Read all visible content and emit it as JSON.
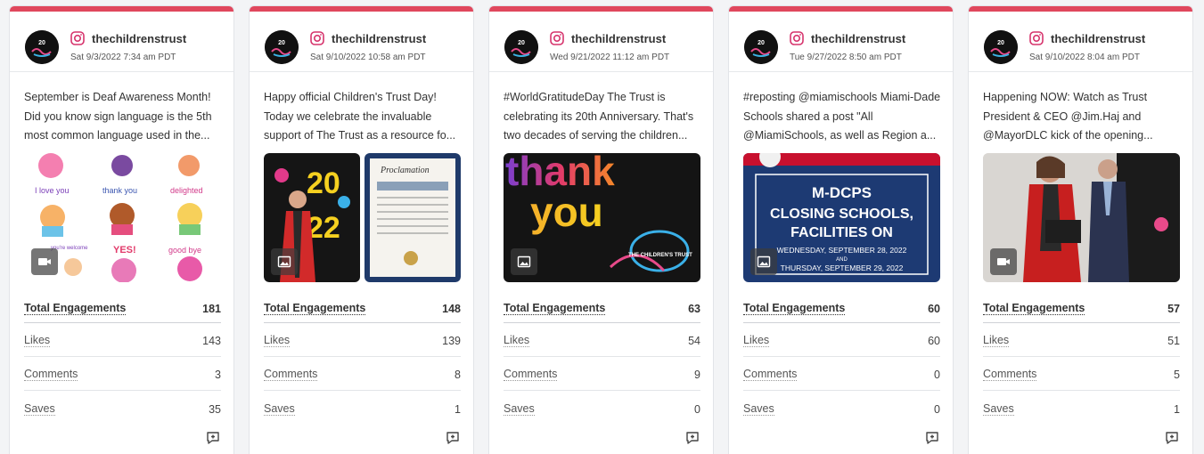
{
  "colors": {
    "accent": "#e0475d",
    "instagram": "#d6336c"
  },
  "metric_labels": {
    "total": "Total Engagements",
    "likes": "Likes",
    "comments": "Comments",
    "saves": "Saves"
  },
  "avatar_text": {
    "logo_year": "20",
    "logo_name": "THE CHILDREN'S TRUST"
  },
  "posts": [
    {
      "handle": "thechildrenstrust",
      "timestamp": "Sat 9/3/2022 7:34 am PDT",
      "caption": "September is Deaf Awareness Month! Did you know sign language is the 5th most common language used in the...",
      "media_type": "video-icon",
      "media_text": [
        "I love you",
        "thank you",
        "delighted",
        "you're welcome",
        "YES!",
        "good bye"
      ],
      "metrics": {
        "total": "181",
        "likes": "143",
        "comments": "3",
        "saves": "35"
      }
    },
    {
      "handle": "thechildrenstrust",
      "timestamp": "Sat 9/10/2022 10:58 am PDT",
      "caption": "Happy official Children's Trust Day! Today we celebrate the invaluable support of The Trust as a resource fo...",
      "media_type": "image-icon",
      "media_text": [
        "20",
        "22",
        "Proclamation"
      ],
      "metrics": {
        "total": "148",
        "likes": "139",
        "comments": "8",
        "saves": "1"
      }
    },
    {
      "handle": "thechildrenstrust",
      "timestamp": "Wed 9/21/2022 11:12 am PDT",
      "caption": "#WorldGratitudeDay The Trust is celebrating its 20th Anniversary. That's two decades of serving the children...",
      "media_type": "image-icon",
      "media_text": [
        "thank",
        "you",
        "THE CHILDREN'S TRUST"
      ],
      "metrics": {
        "total": "63",
        "likes": "54",
        "comments": "9",
        "saves": "0"
      }
    },
    {
      "handle": "thechildrenstrust",
      "timestamp": "Tue 9/27/2022 8:50 am PDT",
      "caption": "#reposting @miamischools Miami-Dade Schools shared a post \"All @MiamiSchools, as well as Region a...",
      "media_type": "image-icon",
      "media_text": [
        "M-DCPS",
        "CLOSING SCHOOLS,",
        "FACILITIES ON",
        "WEDNESDAY, SEPTEMBER 28, 2022",
        "AND",
        "THURSDAY, SEPTEMBER 29, 2022"
      ],
      "metrics": {
        "total": "60",
        "likes": "60",
        "comments": "0",
        "saves": "0"
      }
    },
    {
      "handle": "thechildrenstrust",
      "timestamp": "Sat 9/10/2022 8:04 am PDT",
      "caption": "Happening NOW: Watch as Trust President & CEO @Jim.Haj and @MayorDLC kick of the opening...",
      "media_type": "video-icon",
      "media_text": [],
      "metrics": {
        "total": "57",
        "likes": "51",
        "comments": "5",
        "saves": "1"
      }
    }
  ]
}
